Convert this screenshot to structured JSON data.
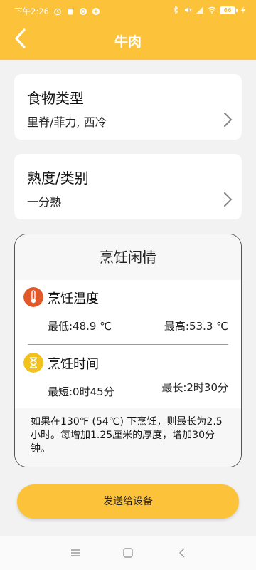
{
  "status": {
    "time": "下午2:26",
    "battery": "66"
  },
  "header": {
    "title": "牛肉",
    "accent_color": "#fcc33a"
  },
  "food_type": {
    "label": "食物类型",
    "value": "里脊/菲力, 西冷"
  },
  "doneness": {
    "label": "熟度/类别",
    "value": "一分熟"
  },
  "cooking_info": {
    "title": "烹饪闲情",
    "temperature": {
      "label": "烹饪温度",
      "min": "最低:48.9 ℃",
      "max": "最高:53.3 ℃",
      "icon": "thermometer-icon"
    },
    "time": {
      "label": "烹饪时间",
      "min": "最短:0时45分",
      "max": "最长:2时30分",
      "icon": "hourglass-icon"
    },
    "note": "如果在130℉ (54℃) 下烹饪，则最长为2.5小时。每增加1.25厘米的厚度，增加30分钟。"
  },
  "send_button": {
    "label": "发送给设备"
  },
  "nav": {
    "icons": [
      "menu-icon",
      "home-icon",
      "back-icon"
    ]
  }
}
